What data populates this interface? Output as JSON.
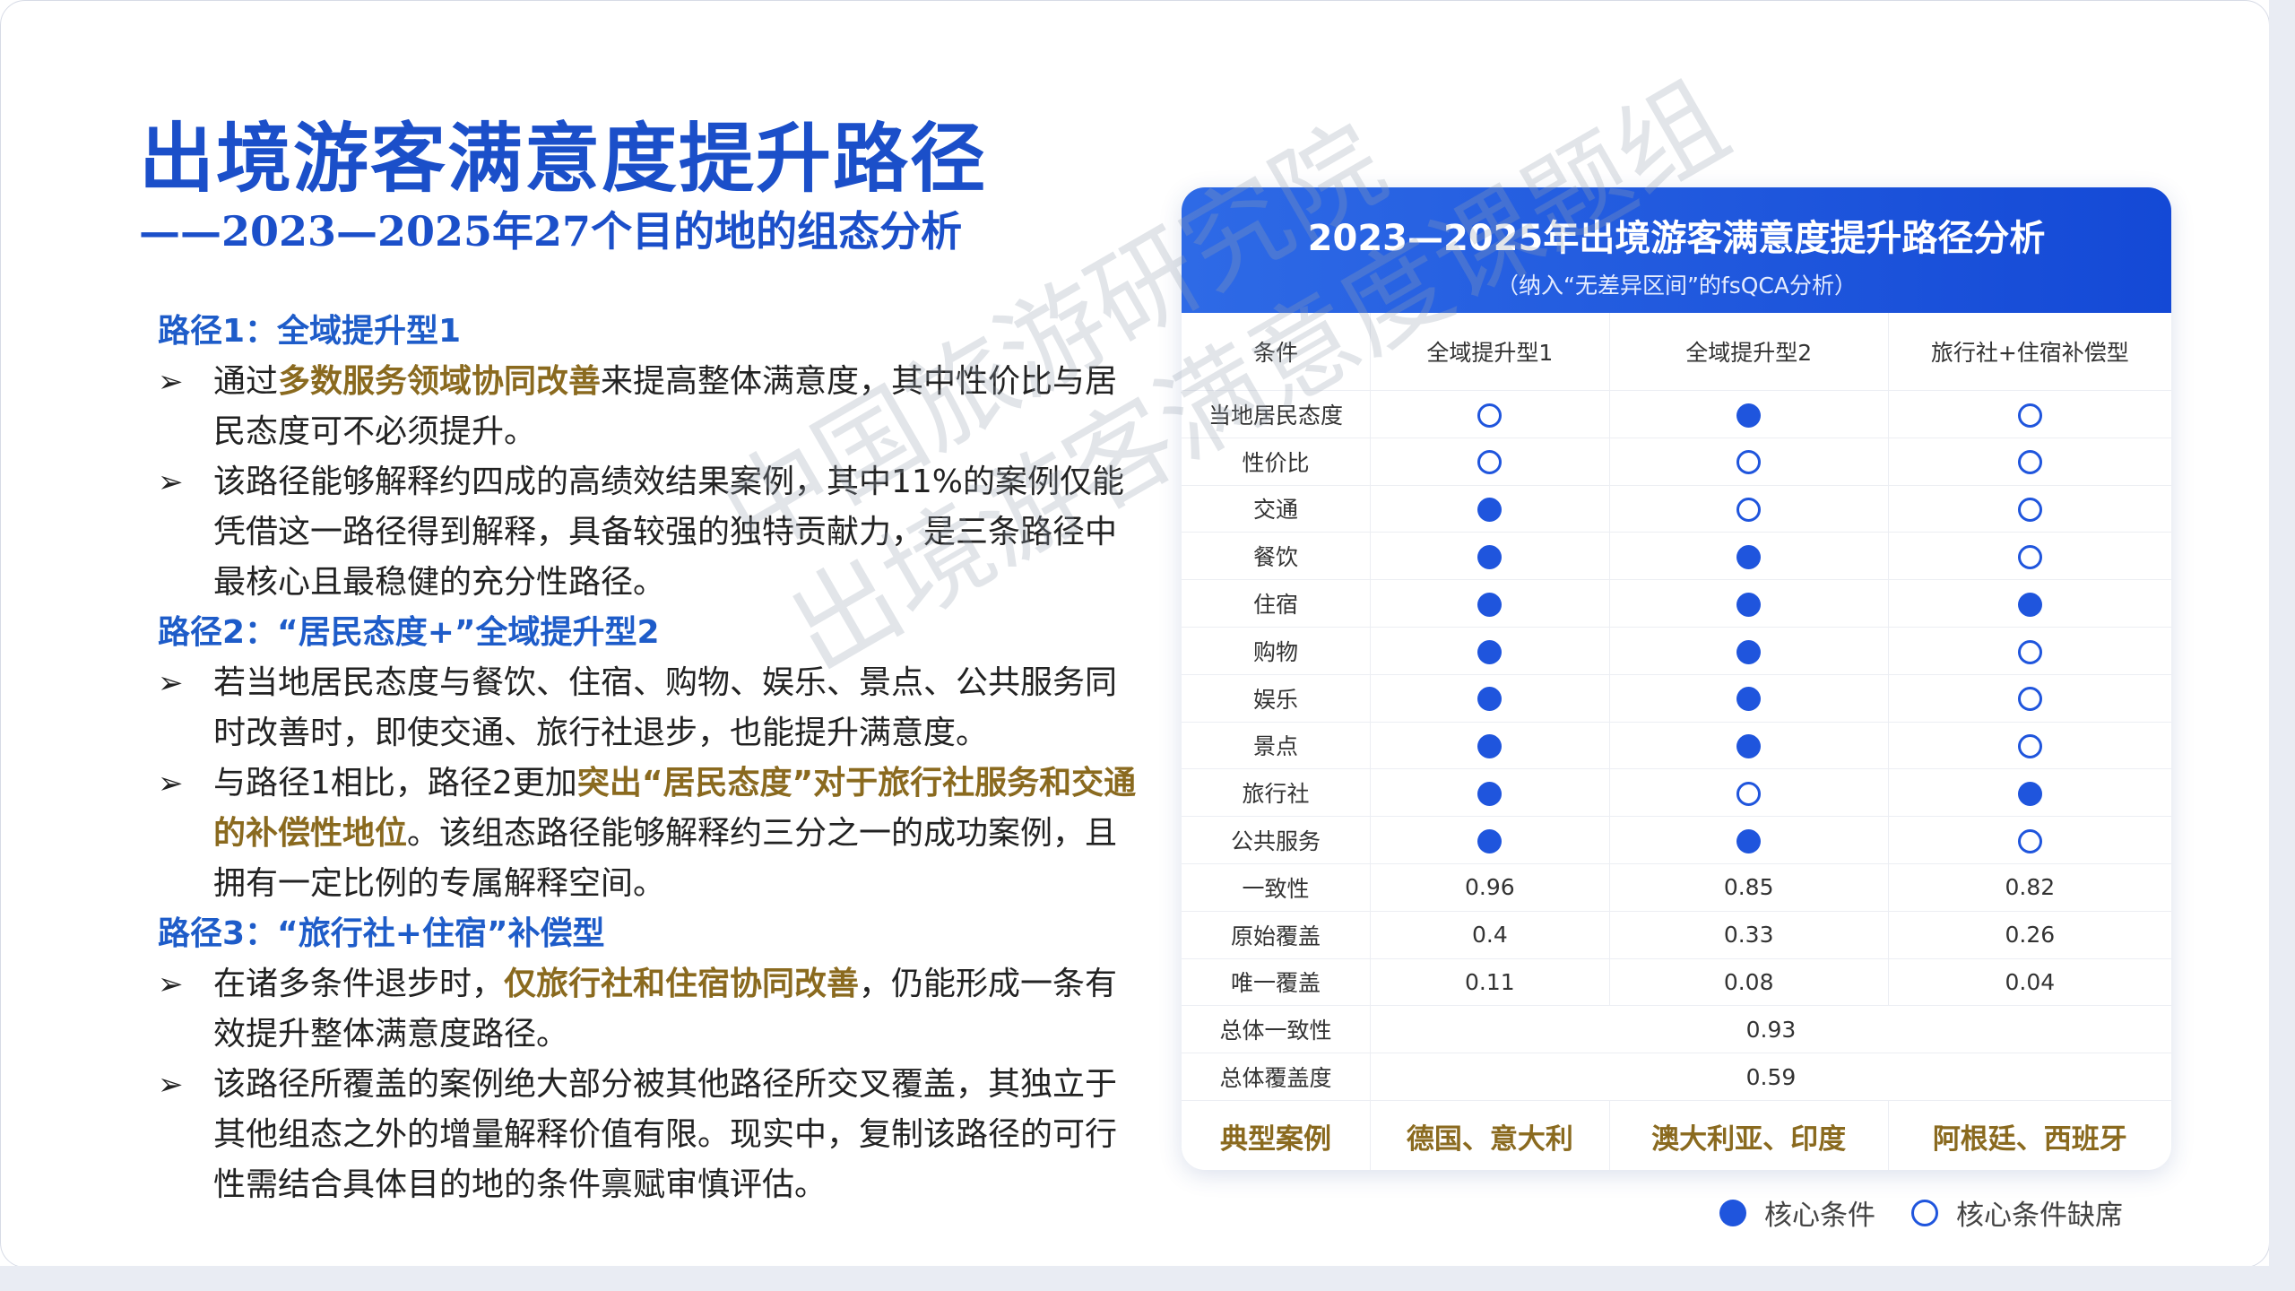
{
  "title": "出境游客满意度提升路径",
  "subtitle": "——2023—2025年27个目的地的组态分析",
  "paths": [
    {
      "head": "路径1：全域提升型1",
      "bullets": [
        {
          "pre": "通过",
          "hl": "多数服务领域协同改善",
          "post": "来提高整体满意度，其中性价比与居民态度可不必须提升。"
        },
        {
          "pre": "该路径能够解释约四成的高绩效结果案例，其中11%的案例仅能凭借这一路径得到解释，具备较强的独特贡献力，是三条路径中最核心且最稳健的充分性路径。",
          "hl": "",
          "post": ""
        }
      ]
    },
    {
      "head": "路径2：“居民态度+”全域提升型2",
      "bullets": [
        {
          "pre": "若当地居民态度与餐饮、住宿、购物、娱乐、景点、公共服务同时改善时，即使交通、旅行社退步，也能提升满意度。",
          "hl": "",
          "post": ""
        },
        {
          "pre": "与路径1相比，路径2更加",
          "hl": "突出“居民态度”对于旅行社服务和交通的补偿性地位",
          "post": "。该组态路径能够解释约三分之一的成功案例，且拥有一定比例的专属解释空间。"
        }
      ]
    },
    {
      "head": "路径3：“旅行社+住宿”补偿型",
      "bullets": [
        {
          "pre": "在诸多条件退步时，",
          "hl": "仅旅行社和住宿协同改善",
          "post": "，仍能形成一条有效提升整体满意度路径。"
        },
        {
          "pre": "该路径所覆盖的案例绝大部分被其他路径所交叉覆盖，其独立于其他组态之外的增量解释价值有限。现实中，复制该路径的可行性需结合具体目的地的条件禀赋审慎评估。",
          "hl": "",
          "post": ""
        }
      ]
    }
  ],
  "watermark": {
    "line1": "中国旅游研究院",
    "line2": "出境游客满意度课题组"
  },
  "table": {
    "title": "2023—2025年出境游客满意度提升路径分析",
    "subtitle": "（纳入“无差异区间”的fsQCA分析）",
    "headers": [
      "条件",
      "全域提升型1",
      "全域提升型2",
      "旅行社+住宿补偿型"
    ],
    "conditions": [
      {
        "label": "当地居民态度",
        "values": [
          "empty",
          "full",
          "empty"
        ]
      },
      {
        "label": "性价比",
        "values": [
          "empty",
          "empty",
          "empty"
        ]
      },
      {
        "label": "交通",
        "values": [
          "full",
          "empty",
          "empty"
        ]
      },
      {
        "label": "餐饮",
        "values": [
          "full",
          "full",
          "empty"
        ]
      },
      {
        "label": "住宿",
        "values": [
          "full",
          "full",
          "full"
        ]
      },
      {
        "label": "购物",
        "values": [
          "full",
          "full",
          "empty"
        ]
      },
      {
        "label": "娱乐",
        "values": [
          "full",
          "full",
          "empty"
        ]
      },
      {
        "label": "景点",
        "values": [
          "full",
          "full",
          "empty"
        ]
      },
      {
        "label": "旅行社",
        "values": [
          "full",
          "empty",
          "full"
        ]
      },
      {
        "label": "公共服务",
        "values": [
          "full",
          "full",
          "empty"
        ]
      }
    ],
    "metrics": [
      {
        "label": "一致性",
        "values": [
          "0.96",
          "0.85",
          "0.82"
        ]
      },
      {
        "label": "原始覆盖",
        "values": [
          "0.4",
          "0.33",
          "0.26"
        ]
      },
      {
        "label": "唯一覆盖",
        "values": [
          "0.11",
          "0.08",
          "0.04"
        ]
      }
    ],
    "overall": [
      {
        "label": "总体一致性",
        "value": "0.93"
      },
      {
        "label": "总体覆盖度",
        "value": "0.59"
      }
    ],
    "cases": {
      "label": "典型案例",
      "values": [
        "德国、意大利",
        "澳大利亚、印度",
        "阿根廷、西班牙"
      ]
    }
  },
  "legend": {
    "full": "核心条件",
    "empty": "核心条件缺席"
  },
  "colors": {
    "accent": "#1b4fc9",
    "highlight": "#8a6a1f",
    "dot": "#1f55dd"
  }
}
